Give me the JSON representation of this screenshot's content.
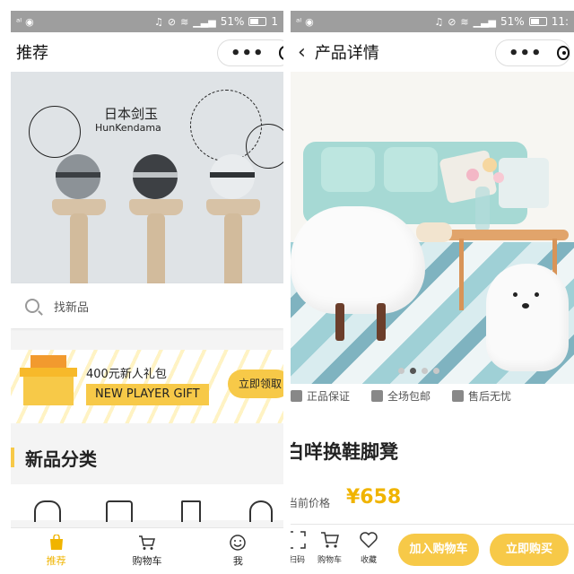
{
  "status_bar": {
    "battery": "51%",
    "time_left": "1",
    "time_right": "11:"
  },
  "left_screen": {
    "nav_title": "推荐",
    "banner": {
      "caption_cn": "日本剑玉",
      "caption_en": "HunKendama"
    },
    "search": {
      "placeholder": "找新品"
    },
    "gift": {
      "title": "400元新人礼包",
      "tag": "NEW PLAYER GIFT",
      "claim_button": "立即领取"
    },
    "section_title": "新品分类",
    "tabs": [
      {
        "label": "推荐",
        "icon": "bag-icon",
        "active": true
      },
      {
        "label": "购物车",
        "icon": "cart-icon",
        "active": false
      },
      {
        "label": "我",
        "icon": "smile-icon",
        "active": false
      }
    ]
  },
  "right_screen": {
    "nav_title": "产品详情",
    "guarantees": [
      "正品保证",
      "全场包邮",
      "售后无忧"
    ],
    "product_name": "白咩换鞋脚凳",
    "price_label": "当前价格",
    "price": "¥658",
    "actions": [
      {
        "label": "扫码",
        "icon": "scan-icon"
      },
      {
        "label": "购物车",
        "icon": "cart-icon"
      },
      {
        "label": "收藏",
        "icon": "heart-icon"
      }
    ],
    "add_to_cart": "加入购物车",
    "buy_now": "立即购买",
    "carousel_page": 1,
    "carousel_total": 4
  },
  "colors": {
    "accent": "#f7c948",
    "price": "#f0b400",
    "status_bar": "#9e9e9e"
  }
}
